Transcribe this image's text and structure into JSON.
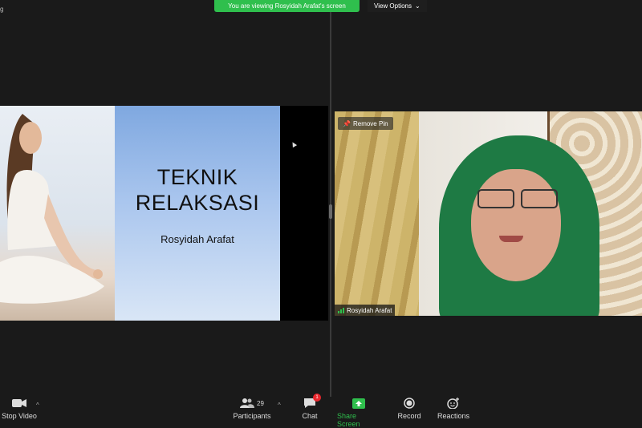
{
  "banner": {
    "viewing_text": "You are viewing Rosyidah Arafat's screen"
  },
  "view_options": {
    "label": "View Options",
    "chevron": "chevron-down-icon"
  },
  "corner": {
    "text": "g"
  },
  "slide": {
    "title_line1": "TEKNIK",
    "title_line2": "RELAKSASI",
    "author": "Rosyidah Arafat"
  },
  "video": {
    "remove_pin_label": "Remove Pin",
    "participant_name": "Rosyidah Arafat"
  },
  "toolbar": {
    "stop_video_label": "Stop Video",
    "participants_label": "Participants",
    "participants_count": "29",
    "chat_label": "Chat",
    "chat_badge": "1",
    "share_screen_label": "Share Screen",
    "record_label": "Record",
    "reactions_label": "Reactions"
  },
  "colors": {
    "share_green": "#2fbf4d",
    "badge_red": "#e8262d",
    "hijab_green": "#1e7a44"
  }
}
